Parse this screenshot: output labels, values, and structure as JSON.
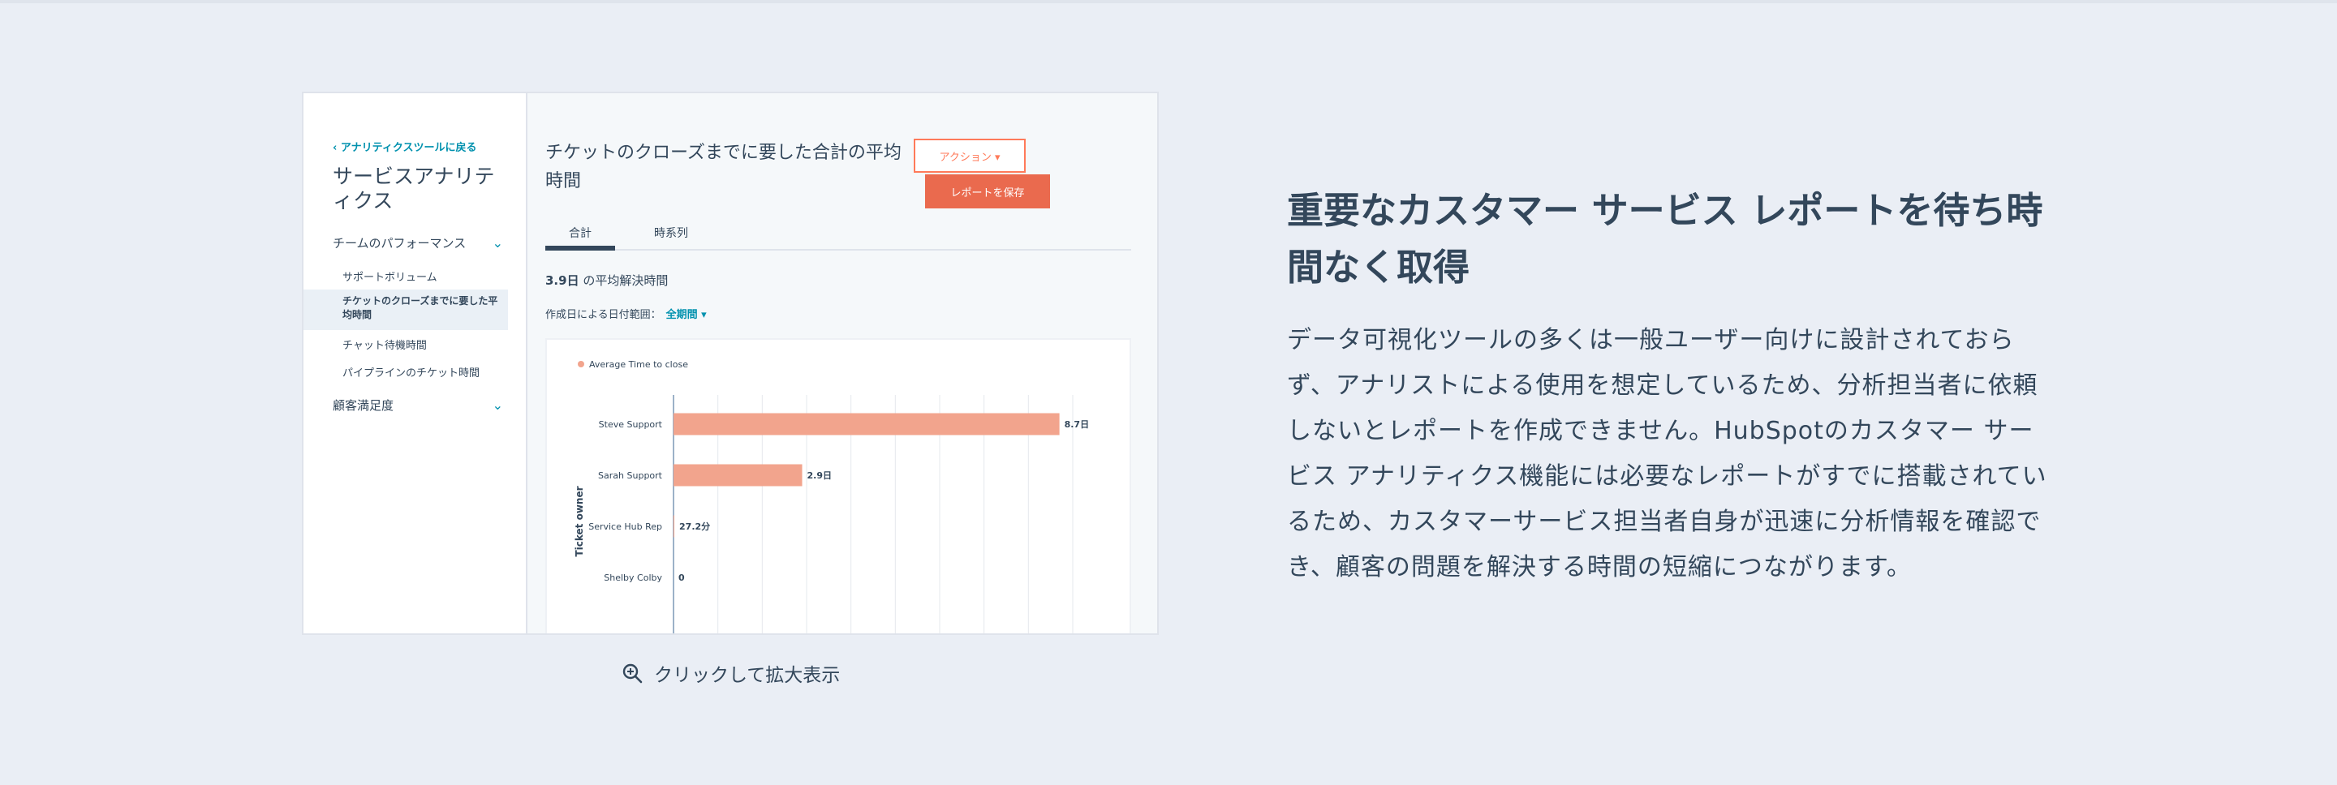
{
  "screenshot": {
    "back_link": "‹ アナリティクスツールに戻る",
    "sidebar_title": "サービスアナリティクス",
    "nav": {
      "group_team": "チームのパフォーマンス",
      "items": [
        "サポートボリューム",
        "チケットのクローズまでに要した平均時間",
        "チャット待機時間",
        "パイプラインのチケット時間"
      ],
      "group_csat": "顧客満足度"
    },
    "report_title": "チケットのクローズまでに要した合計の平均時間",
    "action_button": "アクション ▾",
    "save_button": "レポートを保存",
    "tabs": [
      "合計",
      "時系列"
    ],
    "metric_value": "3.9日",
    "metric_suffix": " の平均解決時間",
    "date_label": "作成日による日付範囲：",
    "date_value": "全期間 ▾"
  },
  "chart_data": {
    "type": "bar",
    "orientation": "horizontal",
    "legend": "Average Time to close",
    "ylabel": "Ticket owner",
    "categories": [
      "Steve Support",
      "Sarah Support",
      "Service Hub Rep",
      "Shelby Colby"
    ],
    "values": [
      8.7,
      2.9,
      0.019,
      0
    ],
    "value_labels": [
      "8.7日",
      "2.9日",
      "27.2分",
      "0"
    ],
    "xlim": [
      0,
      9
    ],
    "color": "#f2a48d",
    "grid": true
  },
  "caption": "クリックして拡大表示",
  "heading": "重要なカスタマー サービス レポートを待ち時間なく取得",
  "body": "データ可視化ツールの多くは一般ユーザー向けに設計されておらず、アナリストによる使用を想定しているため、分析担当者に依頼しないとレポートを作成できません。HubSpotのカスタマー サービス アナリティクス機能には必要なレポートがすでに搭載されているため、カスタマーサービス担当者自身が迅速に分析情報を確認でき、顧客の問題を解決する時間の短縮につながります。"
}
